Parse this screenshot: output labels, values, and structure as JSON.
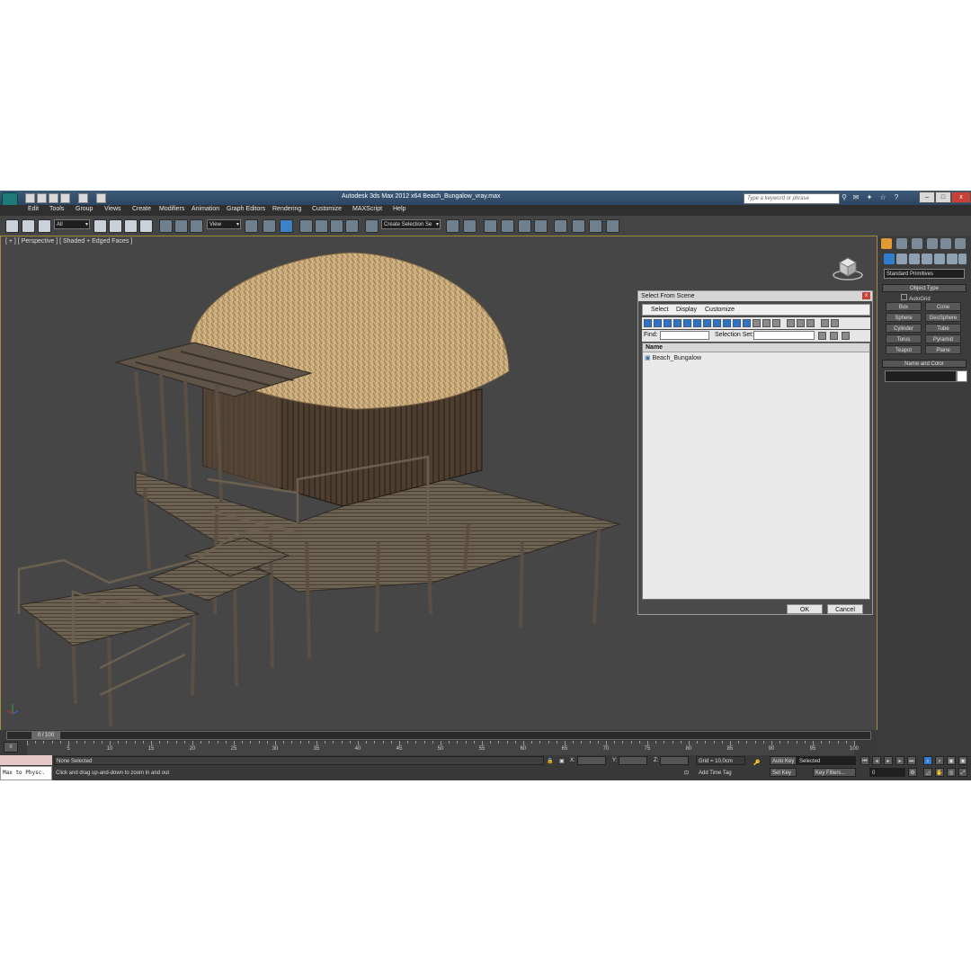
{
  "window": {
    "title": "Autodesk 3ds Max  2012 x64      Beach_Bungalow_vray.max",
    "search_placeholder": "Type a keyword or phrase"
  },
  "menu": [
    "Edit",
    "Tools",
    "Group",
    "Views",
    "Create",
    "Modifiers",
    "Animation",
    "Graph Editors",
    "Rendering",
    "Customize",
    "MAXScript",
    "Help"
  ],
  "toolbar": {
    "selection_filter": "All",
    "ref_coord": "View",
    "named_selection": "Create Selection Se"
  },
  "viewport": {
    "label": "[ + ] [ Perspective ] [ Shaded + Edged Faces ]"
  },
  "dialog": {
    "title": "Select From Scene",
    "menu": [
      "Select",
      "Display",
      "Customize"
    ],
    "find_label": "Find:",
    "selset_label": "Selection Set:",
    "column_name": "Name",
    "items": [
      "Beach_Bungalow"
    ],
    "ok": "OK",
    "cancel": "Cancel",
    "close": "x"
  },
  "command_panel": {
    "category": "Standard Primitives",
    "object_type_header": "Object Type",
    "autogrid": "AutoGrid",
    "buttons": [
      "Box",
      "Cone",
      "Sphere",
      "GeoSphere",
      "Cylinder",
      "Tube",
      "Torus",
      "Pyramid",
      "Teapot",
      "Plane"
    ],
    "name_color_header": "Name and Color"
  },
  "timeline": {
    "slider": "0 / 100",
    "ticks": [
      "5",
      "10",
      "15",
      "20",
      "25",
      "30",
      "35",
      "40",
      "45",
      "50",
      "55",
      "60",
      "65",
      "70",
      "75",
      "80",
      "85",
      "90",
      "95",
      "100"
    ]
  },
  "status": {
    "selected": "None Selected",
    "prompt": "Click and drag up-and-down to zoom in and out",
    "x_label": "X:",
    "y_label": "Y:",
    "z_label": "Z:",
    "grid": "Grid = 10,0cm",
    "add_time_tag": "Add Time Tag",
    "auto_key": "Auto Key",
    "set_key": "Set Key",
    "key_mode": "Selected",
    "key_filters": "Key Filters...",
    "frame": "0",
    "maxscript": "Max to Physc."
  }
}
